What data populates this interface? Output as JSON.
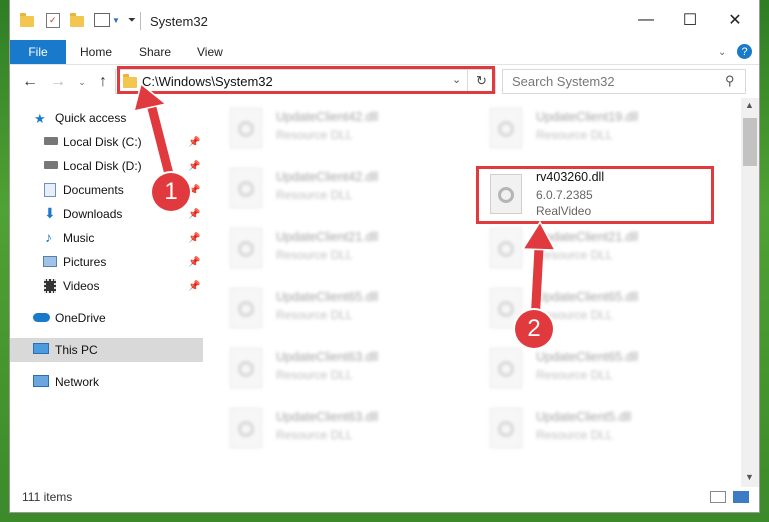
{
  "window": {
    "title": "System32"
  },
  "ribbon": {
    "file": "File",
    "home": "Home",
    "share": "Share",
    "view": "View"
  },
  "address": {
    "path": "C:\\Windows\\System32"
  },
  "search": {
    "placeholder": "Search System32"
  },
  "sidebar": {
    "quick_access": "Quick access",
    "items": [
      {
        "label": "Local Disk (C:)",
        "icon": "drive-icon"
      },
      {
        "label": "Local Disk (D:)",
        "icon": "drive-icon"
      },
      {
        "label": "Documents",
        "icon": "documents-icon"
      },
      {
        "label": "Downloads",
        "icon": "downloads-icon"
      },
      {
        "label": "Music",
        "icon": "music-icon"
      },
      {
        "label": "Pictures",
        "icon": "pictures-icon"
      },
      {
        "label": "Videos",
        "icon": "videos-icon"
      }
    ],
    "onedrive": "OneDrive",
    "this_pc": "This PC",
    "network": "Network"
  },
  "files": {
    "left": [
      {
        "name": "UpdateClient42.dll",
        "type": "Resource DLL"
      },
      {
        "name": "UpdateClient42.dll",
        "type": "Resource DLL"
      },
      {
        "name": "UpdateClient21.dll",
        "type": "Resource DLL"
      },
      {
        "name": "UpdateClient65.dll",
        "type": "Resource DLL"
      },
      {
        "name": "UpdateClient63.dll",
        "type": "Resource DLL"
      },
      {
        "name": "UpdateClient63.dll",
        "type": "Resource DLL"
      }
    ],
    "right": [
      {
        "name": "UpdateClient19.dll",
        "type": "Resource DLL"
      },
      {
        "name": "UpdateClient21.dll",
        "type": "Resource DLL"
      },
      {
        "name": "UpdateClient65.dll",
        "type": "Resource DLL"
      },
      {
        "name": "UpdateClient65.dll",
        "type": "Resource DLL"
      },
      {
        "name": "UpdateClient5.dll",
        "type": "Resource DLL"
      }
    ],
    "highlighted": {
      "name": "rv403260.dll",
      "version": "6.0.7.2385",
      "company": "RealVideo"
    }
  },
  "status": {
    "count": "111 items"
  },
  "annotations": {
    "step1": "1",
    "step2": "2",
    "color": "#e0393e"
  }
}
